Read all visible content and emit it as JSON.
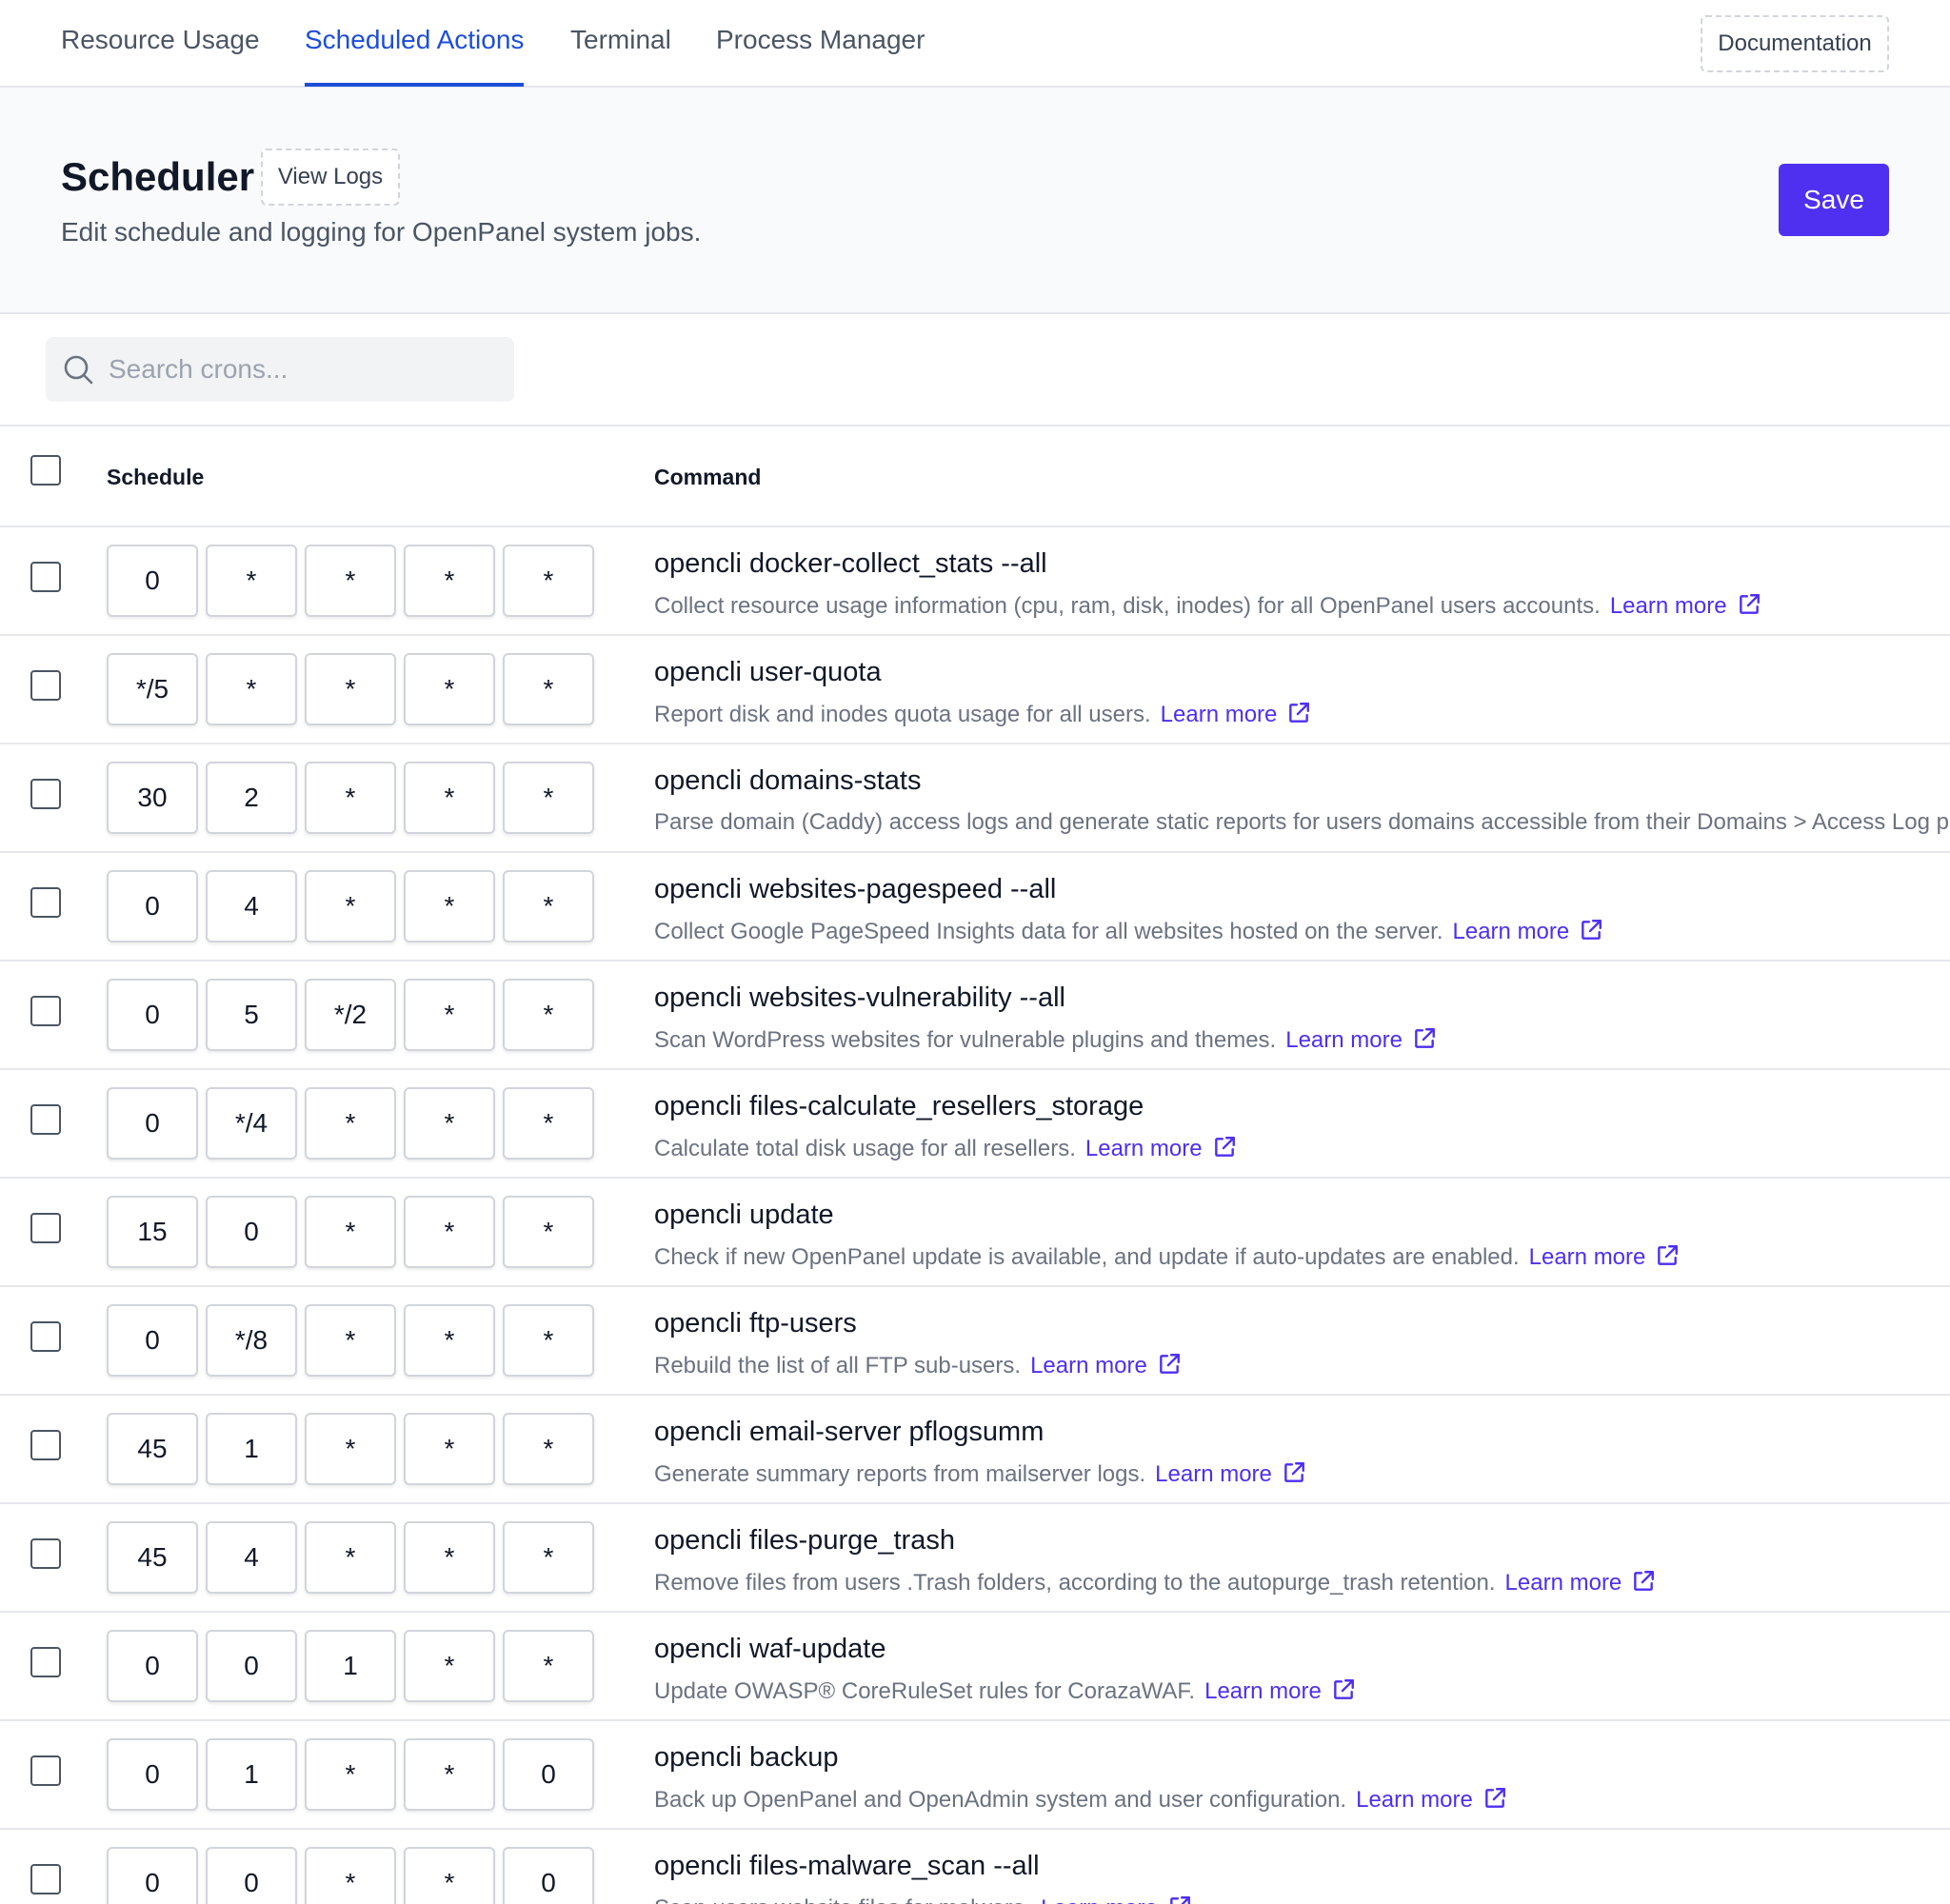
{
  "tabs": [
    {
      "label": "Resource Usage",
      "active": false
    },
    {
      "label": "Scheduled Actions",
      "active": true
    },
    {
      "label": "Terminal",
      "active": false
    },
    {
      "label": "Process Manager",
      "active": false
    }
  ],
  "documentation_label": "Documentation",
  "header": {
    "title": "Scheduler",
    "view_logs_label": "View Logs",
    "subtitle": "Edit schedule and logging for OpenPanel system jobs.",
    "save_label": "Save"
  },
  "search": {
    "placeholder": "Search crons...",
    "value": ""
  },
  "table": {
    "columns": {
      "schedule": "Schedule",
      "command": "Command"
    },
    "learn_more_label": "Learn more",
    "rows": [
      {
        "schedule": [
          "0",
          "*",
          "*",
          "*",
          "*"
        ],
        "command": "opencli docker-collect_stats --all",
        "description": "Collect resource usage information (cpu, ram, disk, inodes) for all OpenPanel users accounts.",
        "has_link": true
      },
      {
        "schedule": [
          "*/5",
          "*",
          "*",
          "*",
          "*"
        ],
        "command": "opencli user-quota",
        "description": "Report disk and inodes quota usage for all users.",
        "has_link": true
      },
      {
        "schedule": [
          "30",
          "2",
          "*",
          "*",
          "*"
        ],
        "command": "opencli domains-stats",
        "description": "Parse domain (Caddy) access logs and generate static reports for users domains accessible from their Domains > Access Log p",
        "has_link": false
      },
      {
        "schedule": [
          "0",
          "4",
          "*",
          "*",
          "*"
        ],
        "command": "opencli websites-pagespeed --all",
        "description": "Collect Google PageSpeed Insights data for all websites hosted on the server.",
        "has_link": true
      },
      {
        "schedule": [
          "0",
          "5",
          "*/2",
          "*",
          "*"
        ],
        "command": "opencli websites-vulnerability --all",
        "description": "Scan WordPress websites for vulnerable plugins and themes.",
        "has_link": true
      },
      {
        "schedule": [
          "0",
          "*/4",
          "*",
          "*",
          "*"
        ],
        "command": "opencli files-calculate_resellers_storage",
        "description": "Calculate total disk usage for all resellers.",
        "has_link": true
      },
      {
        "schedule": [
          "15",
          "0",
          "*",
          "*",
          "*"
        ],
        "command": "opencli update",
        "description": "Check if new OpenPanel update is available, and update if auto-updates are enabled.",
        "has_link": true
      },
      {
        "schedule": [
          "0",
          "*/8",
          "*",
          "*",
          "*"
        ],
        "command": "opencli ftp-users",
        "description": "Rebuild the list of all FTP sub-users.",
        "has_link": true
      },
      {
        "schedule": [
          "45",
          "1",
          "*",
          "*",
          "*"
        ],
        "command": "opencli email-server pflogsumm",
        "description": "Generate summary reports from mailserver logs.",
        "has_link": true
      },
      {
        "schedule": [
          "45",
          "4",
          "*",
          "*",
          "*"
        ],
        "command": "opencli files-purge_trash",
        "description": "Remove files from users .Trash folders, according to the autopurge_trash retention.",
        "has_link": true
      },
      {
        "schedule": [
          "0",
          "0",
          "1",
          "*",
          "*"
        ],
        "command": "opencli waf-update",
        "description": "Update OWASP® CoreRuleSet rules for CorazaWAF.",
        "has_link": true
      },
      {
        "schedule": [
          "0",
          "1",
          "*",
          "*",
          "0"
        ],
        "command": "opencli backup",
        "description": "Back up OpenPanel and OpenAdmin system and user configuration.",
        "has_link": true
      },
      {
        "schedule": [
          "0",
          "0",
          "*",
          "*",
          "0"
        ],
        "command": "opencli files-malware_scan --all",
        "description": "Scan users website files for malware.",
        "has_link": true
      }
    ]
  },
  "colors": {
    "accent": "#4f2ff0",
    "active_tab": "#1d4ed8",
    "header_bg": "#f8fafc"
  },
  "icons": {
    "search": "search-icon",
    "external_link": "external-link-icon"
  }
}
